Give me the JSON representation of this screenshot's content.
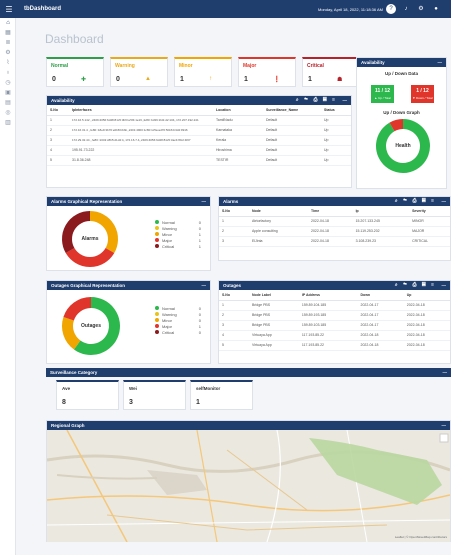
{
  "app": {
    "name": "tbDashboard",
    "datetime": "Monday, April 18, 2022, 11:18:36 AM"
  },
  "page_title": "Dashboard",
  "severity_cards": [
    {
      "label": "Normal",
      "value": "0",
      "color": "#2e9e48",
      "icon": "plus-icon",
      "symbol": "✚"
    },
    {
      "label": "Warning",
      "value": "0",
      "color": "#e8a91b",
      "icon": "warning-icon",
      "symbol": "▲"
    },
    {
      "label": "Minor",
      "value": "1",
      "color": "#f0a500",
      "icon": "arrow-icon",
      "symbol": "↑"
    },
    {
      "label": "Major",
      "value": "1",
      "color": "#e0352b",
      "icon": "exclaim-icon",
      "symbol": "❗"
    },
    {
      "label": "Critical",
      "value": "1",
      "color": "#b8202a",
      "icon": "bug-icon",
      "symbol": "☗"
    }
  ],
  "availability_panel": {
    "title": "Availability",
    "updown_title": "Up / Down Data",
    "up": {
      "value": "11 / 12",
      "sub": "▲ Up / Total"
    },
    "down": {
      "value": "1 / 12",
      "sub": "▼ Down / Total"
    },
    "graph_title": "Up / Down Graph",
    "graph_center": "Health",
    "chart_data": {
      "type": "pie",
      "categories": [
        "Up",
        "Down"
      ],
      "values": [
        11,
        1
      ],
      "colors": [
        "#2db84d",
        "#e0352b"
      ]
    }
  },
  "availability_table": {
    "title": "Availability",
    "columns": [
      "S.No",
      "IpInterfaces",
      "Location",
      "Surveillance_Name",
      "Status"
    ],
    "rows": [
      [
        "1",
        "172.16.5.142 ,,2409:4056:6d48:81c5:3bf3:e5f4:1e16,,fe80::bd39:1fd1:d2:104,,172.207.192.241",
        "TamilNadu",
        "Default",
        "Up"
      ],
      [
        "2",
        "172.16.31.4 ,,fe80::18e9:3b70:e0b8:bbbb,,2401:4900:1c80:1c5a:ad70:5bb6:b3d4:9916",
        "Karnataka",
        "Default",
        "Up"
      ],
      [
        "3",
        "172.29.32.44 ,,fe80::1043:c8b5:d1d4:4,,172.16.7.4,,2409:4056:6d48:81c5:3ac4:f8c2:4f07",
        "Kerala",
        "Default",
        "Up"
      ],
      [
        "4",
        "195.91.73.222",
        "Hiroshima",
        "Default",
        "Up"
      ],
      [
        "5",
        "31.8.36.248",
        "TESTIR",
        "Default",
        "Up"
      ]
    ]
  },
  "alarms_graph": {
    "title": "Alarms Graphical Representation",
    "center": "Alarms",
    "legend": [
      {
        "label": "Normal",
        "value": "0",
        "color": "#2db84d"
      },
      {
        "label": "Warning",
        "value": "0",
        "color": "#e8c31b"
      },
      {
        "label": "Minor",
        "value": "1",
        "color": "#f0a500"
      },
      {
        "label": "Major",
        "value": "1",
        "color": "#e0352b"
      },
      {
        "label": "Critical",
        "value": "1",
        "color": "#8b1a1f"
      }
    ],
    "chart_data": {
      "type": "pie",
      "categories": [
        "Normal",
        "Warning",
        "Minor",
        "Major",
        "Critical"
      ],
      "values": [
        0,
        0,
        1,
        1,
        1
      ]
    }
  },
  "alarms_table": {
    "title": "Alarms",
    "columns": [
      "S.No",
      "Node",
      "Time",
      "Ip",
      "Severity"
    ],
    "rows": [
      [
        "1",
        "Atrtorfactory",
        "2022-04-18",
        "15.207.133.245",
        "MINOR"
      ],
      [
        "2",
        "Apple consulting",
        "2022-04-18",
        "15.119.253.202",
        "MAJOR"
      ],
      [
        "3",
        "ElJinta",
        "2022-04-18",
        "3.108.239.23",
        "CRITICAL"
      ]
    ]
  },
  "outages_graph": {
    "title": "Outages Graphical Representation",
    "center": "Outages",
    "legend": [
      {
        "label": "Normal",
        "value": "0",
        "color": "#2db84d"
      },
      {
        "label": "Warning",
        "value": "0",
        "color": "#e8c31b"
      },
      {
        "label": "Minor",
        "value": "0",
        "color": "#f0a500"
      },
      {
        "label": "Major",
        "value": "1",
        "color": "#e0352b"
      },
      {
        "label": "Critical",
        "value": "0",
        "color": "#8b1a1f"
      }
    ],
    "chart_data": {
      "type": "pie",
      "categories": [
        "Normal",
        "Warning",
        "Minor",
        "Major",
        "Critical"
      ],
      "values": [
        3,
        0,
        1,
        1,
        0
      ]
    }
  },
  "outages_table": {
    "title": "Outages",
    "columns": [
      "S.No",
      "Node Label",
      "IP Address",
      "Down",
      "Up"
    ],
    "rows": [
      [
        "1",
        "Bridge PBS",
        "159.89.104.185",
        "2022-04-17",
        "2022-04-18"
      ],
      [
        "2",
        "Bridge PBS",
        "159.89.193.185",
        "2022-04-17",
        "2022-04-18"
      ],
      [
        "3",
        "Bridge PBS",
        "159.89.103.185",
        "2022-04-17",
        "2022-04-18"
      ],
      [
        "4",
        "Virtuaya App",
        "117.193.85.22",
        "2022-04-18",
        "2022-04-18"
      ],
      [
        "5",
        "Virtuaya App",
        "117.193.85.22",
        "2022-04-18",
        "2022-04-18"
      ]
    ]
  },
  "surveillance": {
    "title": "Surveillance Category",
    "items": [
      {
        "label": "Ave",
        "value": "8"
      },
      {
        "label": "Wei",
        "value": "3"
      },
      {
        "label": "selfMonitor",
        "value": "1"
      }
    ]
  },
  "regional_graph": {
    "title": "Regional Graph",
    "attribution": "Leaflet | © OpenStreetMap contributors"
  },
  "colors": {
    "navy": "#1f3e6e",
    "green": "#2db84d",
    "red": "#e0352b"
  }
}
